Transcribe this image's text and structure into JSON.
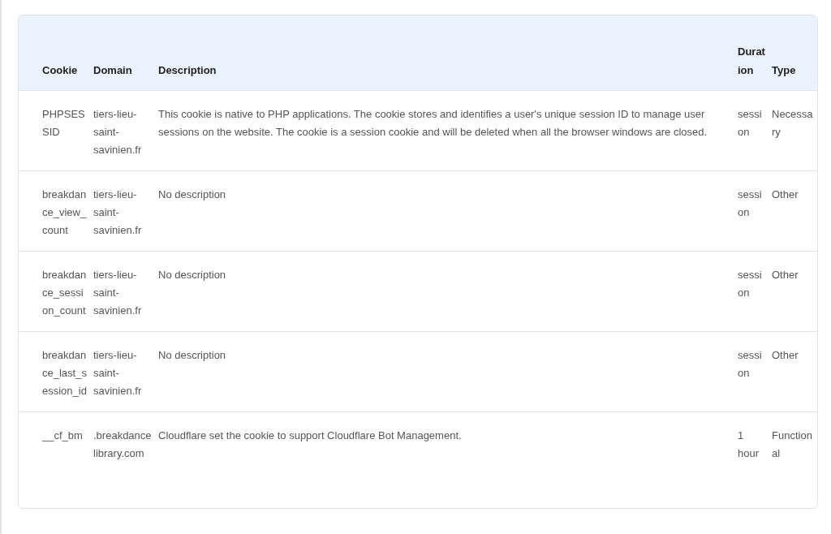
{
  "table": {
    "columns": [
      "Cookie",
      "Domain",
      "Description",
      "Duration",
      "Type"
    ],
    "rows": [
      {
        "cookie": "PHPSESSID",
        "domain": "tiers-lieu-saint-savinien.fr",
        "description": "This cookie is native to PHP applications. The cookie stores and identifies a user's unique session ID to manage user sessions on the website. The cookie is a session cookie and will be deleted when all the browser windows are closed.",
        "duration": "session",
        "type": "Necessary"
      },
      {
        "cookie": "breakdance_view_count",
        "domain": "tiers-lieu-saint-savinien.fr",
        "description": "No description",
        "duration": "session",
        "type": "Other"
      },
      {
        "cookie": "breakdance_session_count",
        "domain": "tiers-lieu-saint-savinien.fr",
        "description": "No description",
        "duration": "session",
        "type": "Other"
      },
      {
        "cookie": "breakdance_last_session_id",
        "domain": "tiers-lieu-saint-savinien.fr",
        "description": "No description",
        "duration": "session",
        "type": "Other"
      },
      {
        "cookie": "__cf_bm",
        "domain": ".breakdancelibrary.com",
        "description": "Cloudflare set the cookie to support Cloudflare Bot Management.",
        "duration": "1 hour",
        "type": "Functional"
      }
    ]
  }
}
